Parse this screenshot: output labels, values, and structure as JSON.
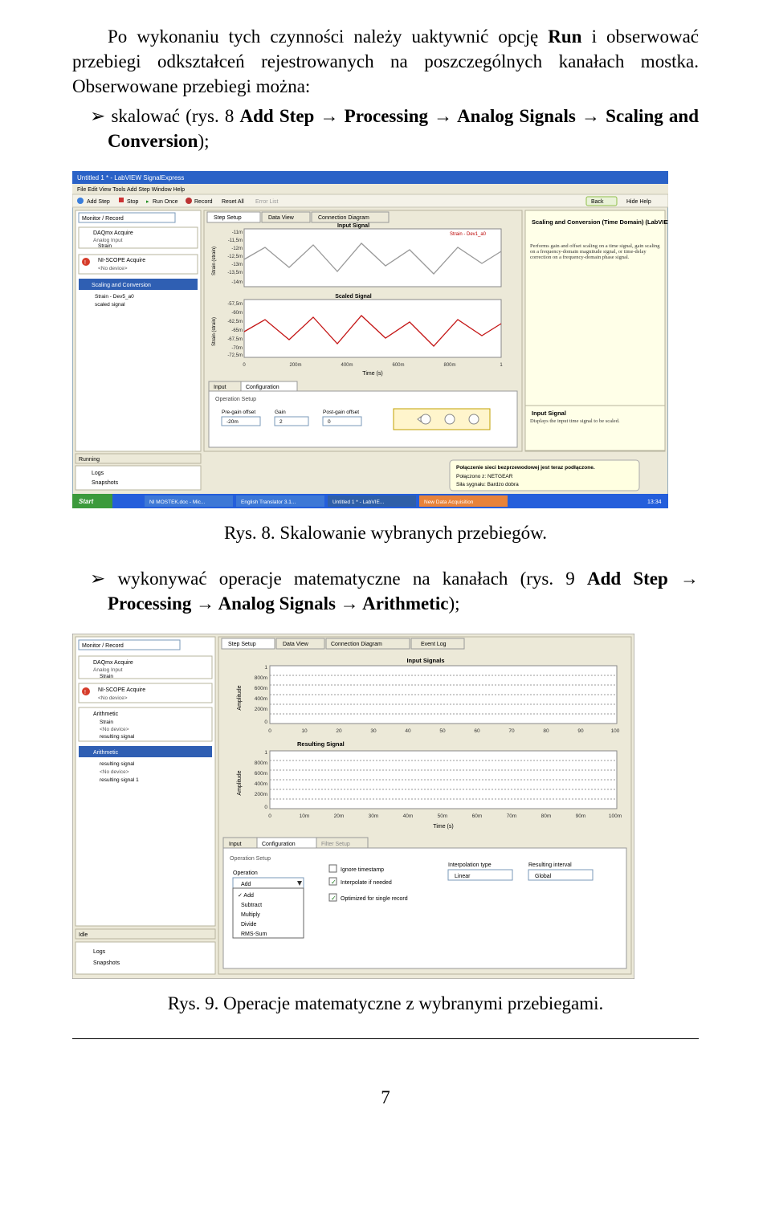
{
  "para1_parts": {
    "t1": "Po wykonaniu tych czynności należy uaktywnić opcję ",
    "run": "Run",
    "t2": " i obserwować przebiegi odkształceń rejestrowanych na poszczególnych kanałach mostka. Obserwowane przebiegi można:"
  },
  "bullet1": {
    "arrow": "➢",
    "t1": " skalować (rys. 8 ",
    "bold": "Add Step → Processing → Analog Signals → Scaling and Conversion",
    "t2": ");"
  },
  "caption1": "Rys. 8. Skalowanie wybranych przebiegów.",
  "bullet2": {
    "arrow": "➢",
    "t1": " wykonywać operacje matematyczne na kanałach (rys. 9 ",
    "bold": "Add Step → Processing → Analog Signals → Arithmetic",
    "t2": ");"
  },
  "caption2": "Rys. 9. Operacje matematyczne z wybranymi przebiegami.",
  "pagenum": "7",
  "fig1": {
    "title": "Untitled 1 * - LabVIEW SignalExpress",
    "menus": "File  Edit  View  Tools  Add Step  Window  Help",
    "toolbar": [
      "Add Step",
      "Stop",
      "Run Once",
      "Record",
      "Reset All",
      "Error List",
      "Back",
      "Hide Help"
    ],
    "left_combo": "Monitor / Record",
    "tree": [
      "DAQmx Acquire",
      "Analog Input",
      "Strain",
      "NI-SCOPE Acquire",
      "<No device>",
      "Scaling and Conversion",
      "Strain - Dev5_a0",
      "scaled signal"
    ],
    "tabs": [
      "Step Setup",
      "Data View",
      "Connection Diagram"
    ],
    "chart1_title": "Input Signal",
    "chart1_legend": "Strain - Dev1_a0",
    "chart1_yticks": [
      "-11m",
      "-11,5m",
      "-12m",
      "-12,5m",
      "-13m",
      "-13,5m",
      "-14m"
    ],
    "ylabel1": "Strain (strain)",
    "chart2_title": "Scaled Signal",
    "chart2_yticks": [
      "-57,5m",
      "-60m",
      "-62,5m",
      "-65m",
      "-67,5m",
      "-70m",
      "-72,5m"
    ],
    "xticks": [
      "0",
      "200m",
      "400m",
      "600m",
      "800m",
      "1"
    ],
    "xlabel": "Time (s)",
    "ylabel2": "Strain (strain)",
    "bottom_tabs": [
      "Input",
      "Configuration"
    ],
    "op_setup": "Operation Setup",
    "fields": [
      "Pre-gain offset",
      "Gain",
      "Post-gain offset"
    ],
    "values": [
      "-20m",
      "2",
      "0"
    ],
    "help_title": "Scaling and Conversion (Time Domain) (LabVIEW SignalExpress)",
    "help_body": "Performs gain and offset scaling on a time signal, gain scaling on a frequency-domain magnitude signal, or time-delay correction on a frequency-domain phase signal.",
    "help2_title": "Input Signal",
    "help2_body": "Displays the input time signal to be scaled.",
    "status": "Running",
    "logs": [
      "Logs",
      "Snapshots"
    ],
    "balloon1": "Połączenie sieci bezprzewodowej jest teraz podłączone.",
    "balloon2": "Połączono z: NETGEAR",
    "balloon3": "Siła sygnału: Bardzo dobra",
    "taskbar_items": [
      "Start",
      "NI MOSTEK.doc - Mic...",
      "English Translator 3.1...",
      "Untitled 1 * - LabVIE...",
      "New Data Acquisition"
    ],
    "clock": "13:34"
  },
  "fig2": {
    "left_combo": "Monitor / Record",
    "tree": [
      "DAQmx Acquire",
      "Analog Input",
      "Strain",
      "NI-SCOPE Acquire",
      "<No device>",
      "Arithmetic",
      "Strain",
      "<No device>",
      "resulting signal",
      "Arithmetic",
      "resulting signal",
      "<No device>",
      "resulting signal 1"
    ],
    "tabs": [
      "Step Setup",
      "Data View",
      "Connection Diagram",
      "Event Log"
    ],
    "chart1_title": "Input Signals",
    "ylabel": "Amplitude",
    "chart1_yticks": [
      "1",
      "800m",
      "600m",
      "400m",
      "200m",
      "0"
    ],
    "chart1_xticks": [
      "0",
      "10",
      "20",
      "30",
      "40",
      "50",
      "60",
      "70",
      "80",
      "90",
      "100"
    ],
    "chart2_title": "Resulting Signal",
    "chart2_yticks": [
      "1",
      "800m",
      "600m",
      "400m",
      "200m",
      "0"
    ],
    "chart2_xticks": [
      "0",
      "10m",
      "20m",
      "30m",
      "40m",
      "50m",
      "60m",
      "70m",
      "80m",
      "90m",
      "100m"
    ],
    "xlabel": "Time (s)",
    "bottom_tabs": [
      "Input",
      "Configuration",
      "Filter Setup"
    ],
    "op_setup": "Operation Setup",
    "op_label": "Operation",
    "op_value": "Add",
    "op_menu": [
      "✓ Add",
      "Subtract",
      "Multiply",
      "Divide",
      "RMS-Sum"
    ],
    "check1": "Ignore timestamp",
    "check2": "Interpolate if needed",
    "check3": "Optimized for single record",
    "interp_label": "Interpolation type",
    "interp_value": "Linear",
    "res_label": "Resulting interval",
    "res_value": "Global",
    "status": "Idle",
    "logs": [
      "Logs",
      "Snapshots"
    ]
  }
}
